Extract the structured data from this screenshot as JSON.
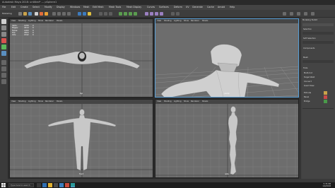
{
  "window": {
    "title": "Autodesk Maya 2018: untitled* --- pSphere1"
  },
  "menus": [
    "File",
    "Edit",
    "Create",
    "Select",
    "Modify",
    "Display",
    "Windows",
    "Mesh",
    "Edit Mesh",
    "Mesh Tools",
    "Mesh Display",
    "Curves",
    "Surfaces",
    "Deform",
    "UV",
    "Generate",
    "Cache",
    "Arnold",
    "Help"
  ],
  "workspace": {
    "label": "Modeling"
  },
  "viewports": [
    {
      "name": "top",
      "camera": "top",
      "menu": [
        "View",
        "Shading",
        "Lighting",
        "Show",
        "Renderer",
        "Panels"
      ]
    },
    {
      "name": "persp",
      "camera": "persp",
      "menu": [
        "View",
        "Shading",
        "Lighting",
        "Show",
        "Renderer",
        "Panels"
      ]
    },
    {
      "name": "front",
      "camera": "front",
      "menu": [
        "View",
        "Shading",
        "Lighting",
        "Show",
        "Renderer",
        "Panels"
      ]
    },
    {
      "name": "side",
      "camera": "side",
      "menu": [
        "View",
        "Shading",
        "Lighting",
        "Show",
        "Renderer",
        "Panels"
      ]
    }
  ],
  "hud": {
    "labels": [
      "Verts:",
      "Edges:",
      "Faces:",
      "Tris:",
      "UVs:"
    ],
    "values": [
      "1456",
      "2914",
      "1460",
      "2904",
      "1542"
    ],
    "zeros": [
      "0",
      "0",
      "0",
      "0",
      "0"
    ]
  },
  "attribute_editor": {
    "title": "Modeling Toolkit",
    "sections": [
      "Selection",
      "Soft Selection",
      "Components",
      "Mesh",
      "Tools"
    ],
    "buttons": [
      "Multi-Cut",
      "Target Weld",
      "Connect",
      "Quad Draw",
      "Extrude",
      "Bevel",
      "Bridge"
    ]
  },
  "taskbar": {
    "search_placeholder": "Type here to search",
    "time": "5:35 PM",
    "date": "1/4/2018"
  },
  "colors": {
    "accent": "#5aa0d8",
    "viewport_bg": "#6d6d6d",
    "grid": "#8a8a8a",
    "model": "#c8c8c8"
  }
}
